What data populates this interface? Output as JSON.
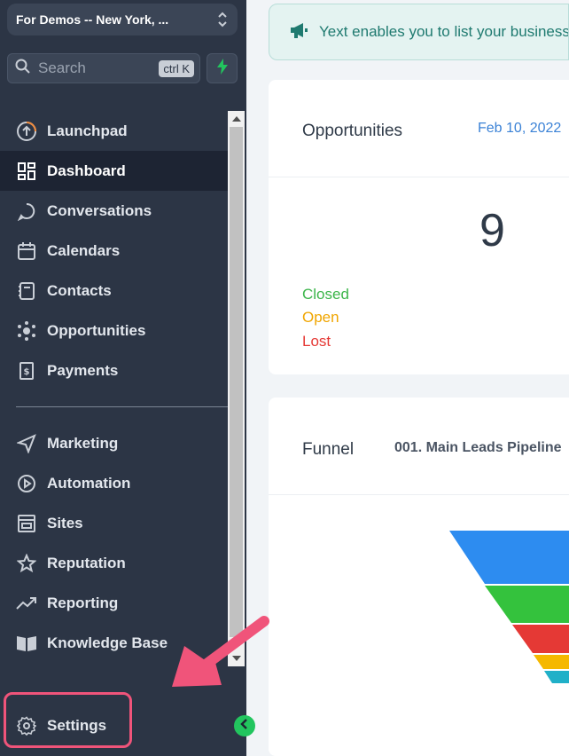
{
  "sidebar": {
    "location": "For Demos -- New York, ...",
    "search_placeholder": "Search",
    "search_shortcut": "ctrl K",
    "items": [
      {
        "label": "Launchpad",
        "icon": "launchpad-icon"
      },
      {
        "label": "Dashboard",
        "icon": "dashboard-icon",
        "active": true
      },
      {
        "label": "Conversations",
        "icon": "chat-icon"
      },
      {
        "label": "Calendars",
        "icon": "calendar-icon"
      },
      {
        "label": "Contacts",
        "icon": "contacts-icon"
      },
      {
        "label": "Opportunities",
        "icon": "opportunities-icon"
      },
      {
        "label": "Payments",
        "icon": "payments-icon"
      }
    ],
    "items2": [
      {
        "label": "Marketing",
        "icon": "send-icon"
      },
      {
        "label": "Automation",
        "icon": "automation-icon"
      },
      {
        "label": "Sites",
        "icon": "sites-icon"
      },
      {
        "label": "Reputation",
        "icon": "star-icon"
      },
      {
        "label": "Reporting",
        "icon": "trend-icon"
      },
      {
        "label": "Knowledge Base",
        "icon": "book-icon"
      }
    ],
    "settings_label": "Settings"
  },
  "banner": {
    "text": "Yext enables you to list your business"
  },
  "opportunities_card": {
    "title": "Opportunities",
    "date": "Feb 10, 2022",
    "count": "9",
    "legend": [
      {
        "label": "Closed",
        "color": "#3cb54a"
      },
      {
        "label": "Open",
        "color": "#f0a500"
      },
      {
        "label": "Lost",
        "color": "#e53935"
      }
    ]
  },
  "funnel_card": {
    "title": "Funnel",
    "pipeline": "001. Main Leads Pipeline",
    "stage_colors": [
      "#2d8cf0",
      "#34c23d",
      "#e53935",
      "#f5b800",
      "#20b0c8"
    ]
  },
  "colors": {
    "sidebar_bg": "#2c3545",
    "accent_green": "#22c55e",
    "annotation_pink": "#f0547a"
  }
}
